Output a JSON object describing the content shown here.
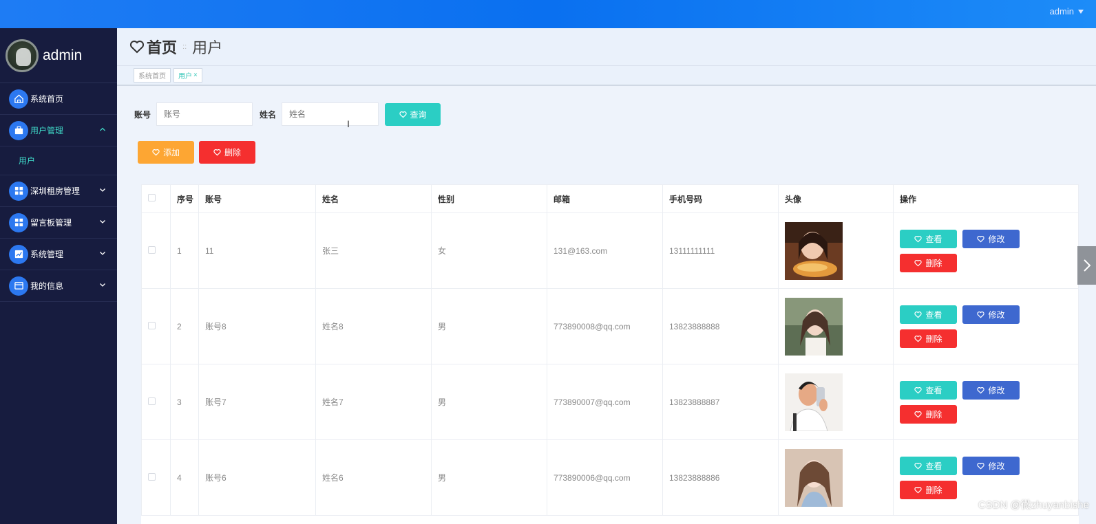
{
  "topbar": {
    "user": "admin"
  },
  "sidebar": {
    "username": "admin",
    "items": [
      {
        "label": "系统首页",
        "icon": "home-icon",
        "active": false,
        "expandable": false
      },
      {
        "label": "用户管理",
        "icon": "briefcase-icon",
        "active": true,
        "expandable": true,
        "expanded": true,
        "sub": [
          {
            "label": "用户"
          }
        ]
      },
      {
        "label": "深圳租房管理",
        "icon": "grid-icon",
        "active": false,
        "expandable": true
      },
      {
        "label": "留言板管理",
        "icon": "grid-icon",
        "active": false,
        "expandable": true
      },
      {
        "label": "系统管理",
        "icon": "chart-icon",
        "active": false,
        "expandable": true
      },
      {
        "label": "我的信息",
        "icon": "card-icon",
        "active": false,
        "expandable": true
      }
    ]
  },
  "header": {
    "home": "首页",
    "separator": "::",
    "current": "用户"
  },
  "tabs": [
    {
      "label": "系统首页",
      "active": false
    },
    {
      "label": "用户",
      "active": true,
      "closable": "×"
    }
  ],
  "search": {
    "account_label": "账号",
    "account_placeholder": "账号",
    "name_label": "姓名",
    "name_placeholder": "姓名",
    "query_button": "查询"
  },
  "actions": {
    "add": "添加",
    "delete": "删除"
  },
  "table": {
    "columns": [
      "序号",
      "账号",
      "姓名",
      "性别",
      "邮箱",
      "手机号码",
      "头像",
      "操作"
    ],
    "rows": [
      {
        "index": "1",
        "account": "11",
        "name": "张三",
        "gender": "女",
        "email": "131@163.com",
        "phone": "13111111111",
        "avatar": "photo-woman-eating"
      },
      {
        "index": "2",
        "account": "账号8",
        "name": "姓名8",
        "gender": "男",
        "email": "773890008@qq.com",
        "phone": "13823888888",
        "avatar": "photo-woman-outdoor"
      },
      {
        "index": "3",
        "account": "账号7",
        "name": "姓名7",
        "gender": "男",
        "email": "773890007@qq.com",
        "phone": "13823888887",
        "avatar": "illustration-man-selfie"
      },
      {
        "index": "4",
        "account": "账号6",
        "name": "姓名6",
        "gender": "男",
        "email": "773890006@qq.com",
        "phone": "13823888886",
        "avatar": "photo-woman-portrait"
      }
    ],
    "row_actions": {
      "view": "查看",
      "edit": "修改",
      "delete": "删除"
    }
  },
  "watermark": "CSDN @微zhuyanbishe",
  "colors": {
    "teal": "#2bcec4",
    "orange": "#fda633",
    "red": "#f52f2f",
    "blue": "#3e68cf",
    "sidebar": "#171c3f",
    "topbar": "#0a70f0"
  }
}
